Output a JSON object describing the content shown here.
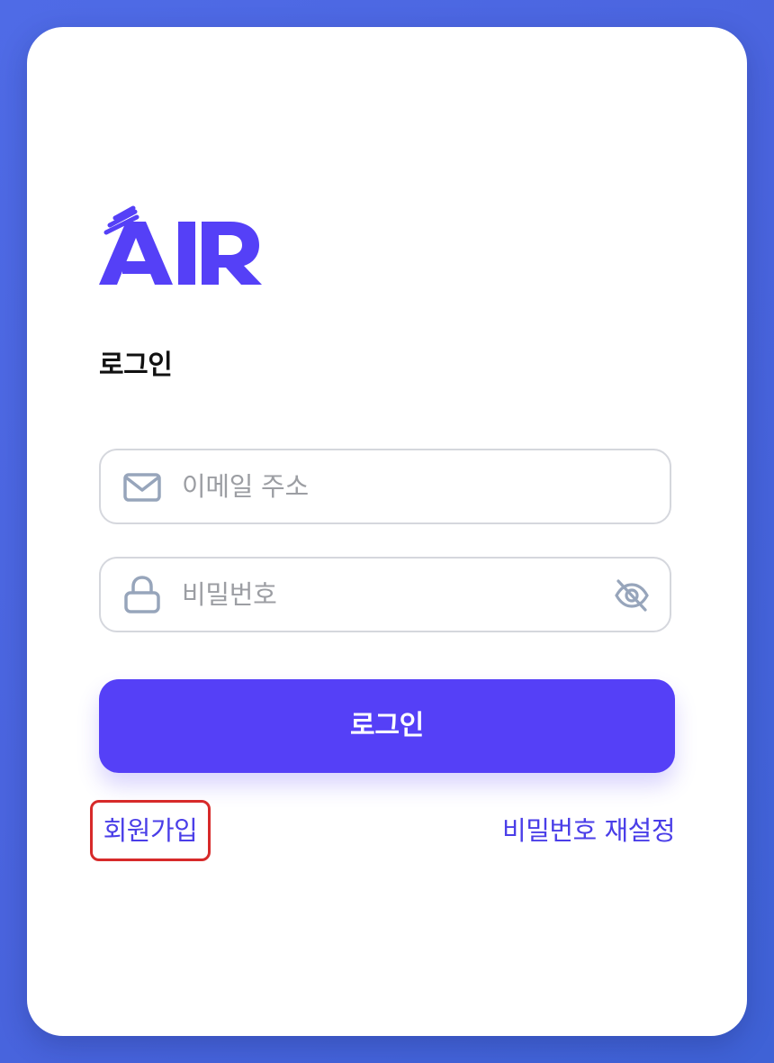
{
  "brand": {
    "logo_text": "AIR",
    "accent_color": "#5540f7"
  },
  "page": {
    "title": "로그인"
  },
  "form": {
    "email": {
      "placeholder": "이메일 주소",
      "icon": "mail-icon"
    },
    "password": {
      "placeholder": "비밀번호",
      "icon": "lock-icon",
      "toggle_icon": "eye-off-icon"
    },
    "submit_label": "로그인"
  },
  "links": {
    "signup": "회원가입",
    "reset_password": "비밀번호 재설정"
  },
  "colors": {
    "background": "#4a64de",
    "link": "#4a3ee8",
    "highlight_border": "#d72a2a",
    "icon": "#97a5bb"
  }
}
